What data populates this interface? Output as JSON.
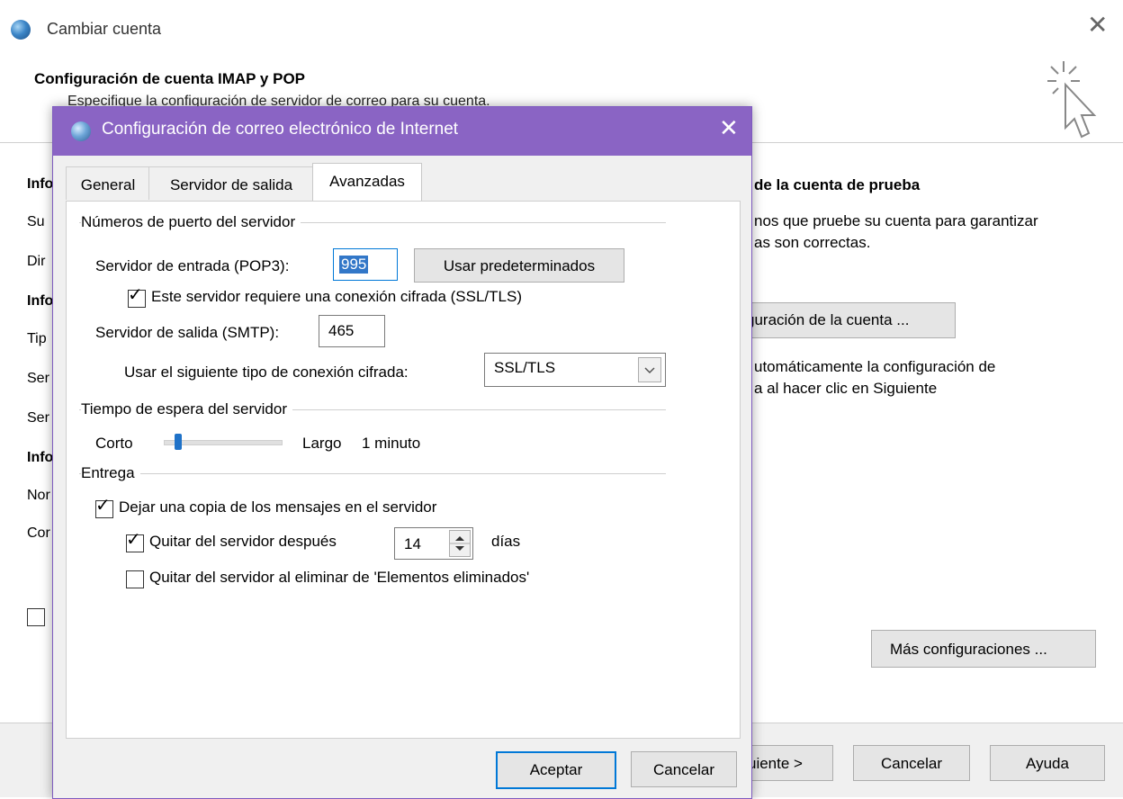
{
  "background_window": {
    "title": "Cambiar cuenta",
    "header_title": "Configuración de cuenta IMAP y POP",
    "header_subtitle": "Especifique la configuración de servidor de correo para su cuenta.",
    "left_column_fragments": [
      "Info",
      "Su",
      "Dir",
      "Info",
      "Tip",
      "Ser",
      "Ser",
      "Info",
      "Nor",
      "Cor"
    ],
    "right_section_title": "de la cuenta de prueba",
    "right_text_line1": "nos que pruebe su cuenta para garantizar",
    "right_text_line2": "as son correctas.",
    "test_button_label": "guración de la cuenta ...",
    "auto_text_line1": "utomáticamente la configuración de",
    "auto_text_line2": "a al hacer clic en Siguiente",
    "more_settings_label": "Más configuraciones ...",
    "next_button_label": "uiente >",
    "cancel_button_label": "Cancelar",
    "help_button_label": "Ayuda"
  },
  "dialog": {
    "title": "Configuración de correo electrónico de Internet",
    "tabs": [
      {
        "label": "General",
        "active": false
      },
      {
        "label": "Servidor de salida",
        "active": false
      },
      {
        "label": "Avanzadas",
        "active": true
      }
    ],
    "ports": {
      "group_label": "Números de puerto del servidor",
      "incoming_label": "Servidor de entrada (POP3):",
      "incoming_value": "995",
      "use_defaults_label": "Usar predeterminados",
      "ssl_required_label": "Este servidor requiere una conexión cifrada (SSL/TLS)",
      "ssl_required_checked": true,
      "outgoing_label": "Servidor de salida (SMTP):",
      "outgoing_value": "465",
      "encryption_label": "Usar el siguiente tipo de conexión cifrada:",
      "encryption_value": "SSL/TLS"
    },
    "timeout": {
      "group_label": "Tiempo de espera del servidor",
      "short_label": "Corto",
      "long_label": "Largo",
      "value_label": "1 minuto",
      "slider_fraction": 0.1
    },
    "delivery": {
      "group_label": "Entrega",
      "leave_copy_label": "Dejar una copia de los mensajes en el servidor",
      "leave_copy_checked": true,
      "remove_after_label": "Quitar del servidor después",
      "remove_after_checked": true,
      "days_value": "14",
      "days_label": "días",
      "remove_deleted_label": "Quitar del servidor al eliminar de 'Elementos eliminados'",
      "remove_deleted_checked": false
    },
    "ok_label": "Aceptar",
    "cancel_label": "Cancelar"
  },
  "colors": {
    "dialog_title_bar": "#8a64c4",
    "focus_border": "#0078d7",
    "selection": "#3277c8"
  }
}
